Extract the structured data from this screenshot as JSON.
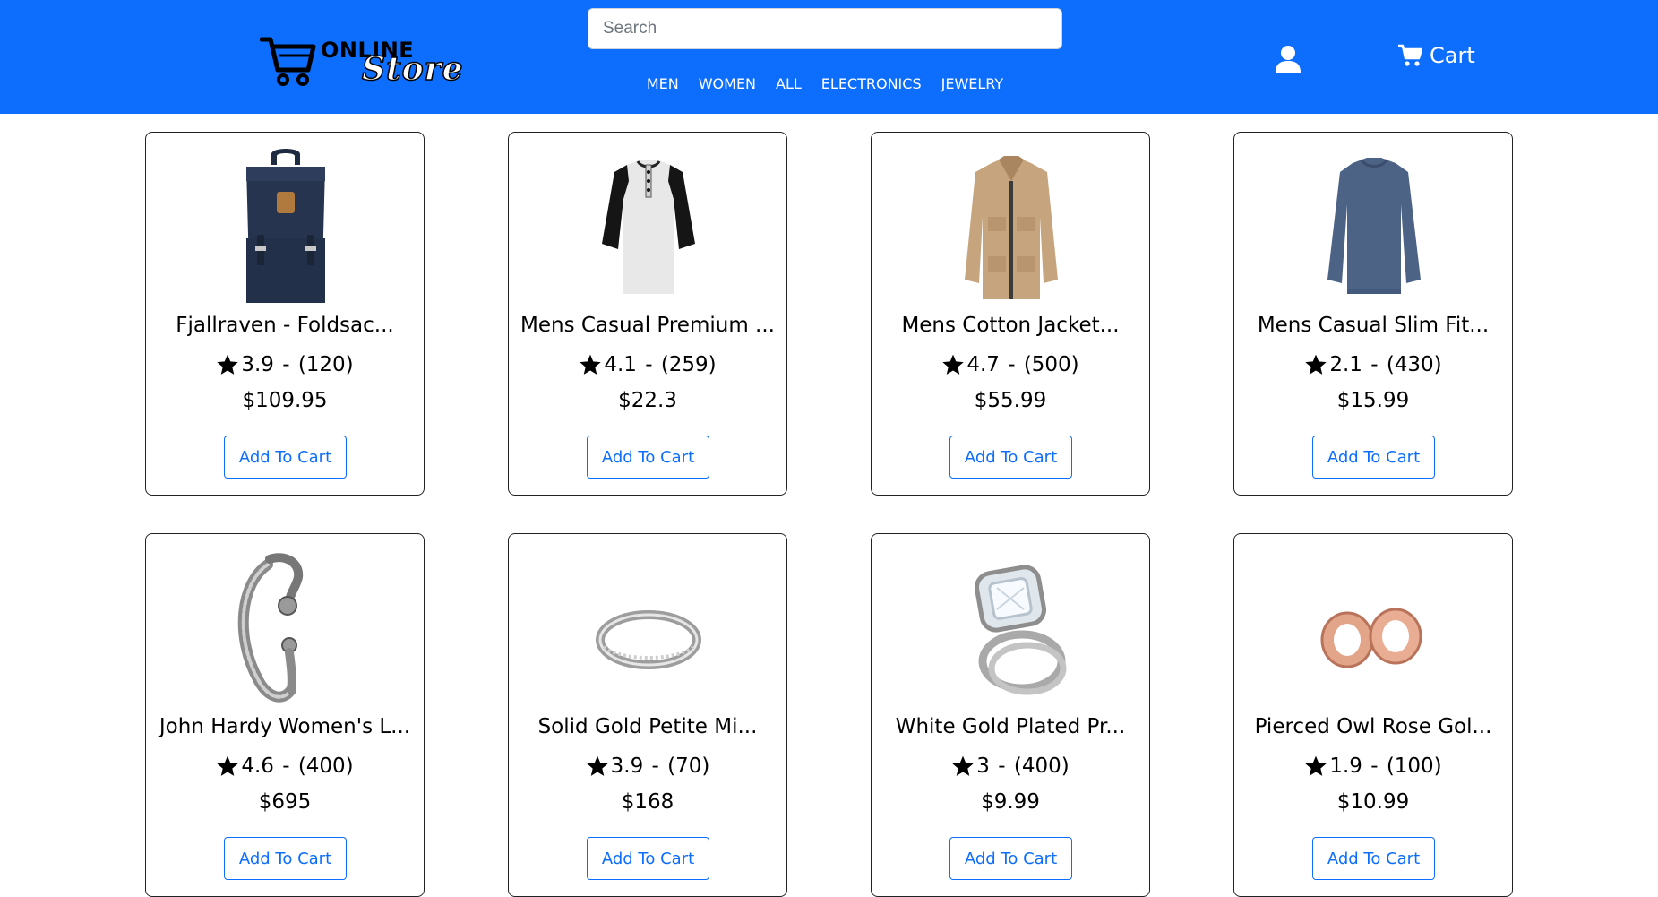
{
  "header": {
    "logo": {
      "line1": "ONLINE",
      "line2": "Store"
    },
    "search": {
      "placeholder": "Search",
      "value": ""
    },
    "nav": [
      {
        "label": "MEN"
      },
      {
        "label": "WOMEN"
      },
      {
        "label": "ALL"
      },
      {
        "label": "ELECTRONICS"
      },
      {
        "label": "JEWELRY"
      }
    ],
    "user_icon": "user-icon",
    "cart": {
      "label": "Cart",
      "icon": "cart-icon"
    },
    "background_color": "#0d6efd"
  },
  "products": [
    {
      "title": "Fjallraven - Foldsac...",
      "rating": "3.9",
      "count": "(120)",
      "price": "$109.95",
      "button": "Add To Cart",
      "image": "backpack"
    },
    {
      "title": "Mens Casual Premium ...",
      "rating": "4.1",
      "count": "(259)",
      "price": "$22.3",
      "button": "Add To Cart",
      "image": "raglan-tshirt"
    },
    {
      "title": "Mens Cotton Jacket...",
      "rating": "4.7",
      "count": "(500)",
      "price": "$55.99",
      "button": "Add To Cart",
      "image": "jacket"
    },
    {
      "title": "Mens Casual Slim Fit...",
      "rating": "2.1",
      "count": "(430)",
      "price": "$15.99",
      "button": "Add To Cart",
      "image": "longsleeve-shirt"
    },
    {
      "title": "John Hardy Women's L...",
      "rating": "4.6",
      "count": "(400)",
      "price": "$695",
      "button": "Add To Cart",
      "image": "bracelet"
    },
    {
      "title": "Solid Gold Petite Mi...",
      "rating": "3.9",
      "count": "(70)",
      "price": "$168",
      "button": "Add To Cart",
      "image": "ring"
    },
    {
      "title": "White Gold Plated Pr...",
      "rating": "3",
      "count": "(400)",
      "price": "$9.99",
      "button": "Add To Cart",
      "image": "diamond-ring"
    },
    {
      "title": "Pierced Owl Rose Gol...",
      "rating": "1.9",
      "count": "(100)",
      "price": "$10.99",
      "button": "Add To Cart",
      "image": "rose-gold-plugs"
    }
  ]
}
